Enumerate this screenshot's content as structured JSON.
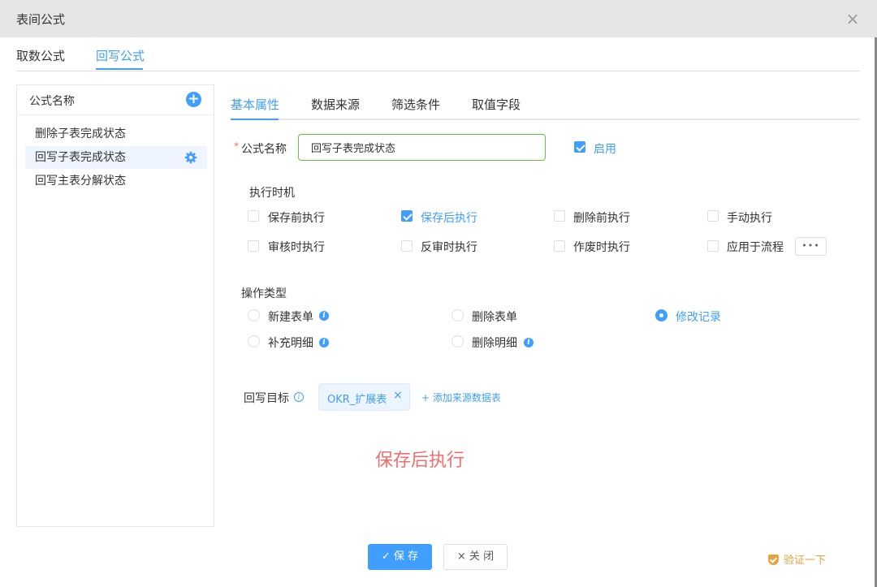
{
  "dialog": {
    "title": "表间公式",
    "close_glyph": "×"
  },
  "top_tabs": [
    {
      "label": "取数公式",
      "active": false
    },
    {
      "label": "回写公式",
      "active": true
    }
  ],
  "left_panel": {
    "header_label": "公式名称",
    "add_glyph": "+",
    "items": [
      {
        "label": "删除子表完成状态",
        "active": false
      },
      {
        "label": "回写子表完成状态",
        "active": true
      },
      {
        "label": "回写主表分解状态",
        "active": false
      }
    ]
  },
  "sub_tabs": [
    {
      "label": "基本属性",
      "active": true
    },
    {
      "label": "数据来源",
      "active": false
    },
    {
      "label": "筛选条件",
      "active": false
    },
    {
      "label": "取值字段",
      "active": false
    }
  ],
  "form": {
    "required_mark": "*",
    "name_label": "公式名称",
    "name_value": "回写子表完成状态",
    "enable_label": "启用",
    "enable_checked": true,
    "timing_label": "执行时机",
    "timing_options": [
      {
        "label": "保存前执行",
        "checked": false
      },
      {
        "label": "保存后执行",
        "checked": true
      },
      {
        "label": "删除前执行",
        "checked": false
      },
      {
        "label": "手动执行",
        "checked": false
      },
      {
        "label": "审核时执行",
        "checked": false
      },
      {
        "label": "反审时执行",
        "checked": false
      },
      {
        "label": "作废时执行",
        "checked": false
      },
      {
        "label": "应用于流程",
        "checked": false
      }
    ],
    "more_glyph": "•••",
    "op_type_label": "操作类型",
    "op_types": [
      {
        "label": "新建表单",
        "selected": false,
        "info": true
      },
      {
        "label": "删除表单",
        "selected": false,
        "info": false
      },
      {
        "label": "修改记录",
        "selected": true,
        "info": false
      },
      {
        "label": "补充明细",
        "selected": false,
        "info": true
      },
      {
        "label": "删除明细",
        "selected": false,
        "info": true
      }
    ],
    "info_glyph": "i",
    "target_label": "回写目标",
    "target_tag": "OKR_扩展表",
    "tag_close_glyph": "×",
    "add_source_label": "+ 添加来源数据表"
  },
  "annotation": "保存后执行",
  "footer": {
    "save_label": "✓ 保 存",
    "close_label": "× 关 闭",
    "verify_label": "验证一下"
  },
  "colors": {
    "accent": "#409eff",
    "success_border": "#67c23a",
    "danger": "#f56c6c",
    "warning": "#e6a23c"
  }
}
